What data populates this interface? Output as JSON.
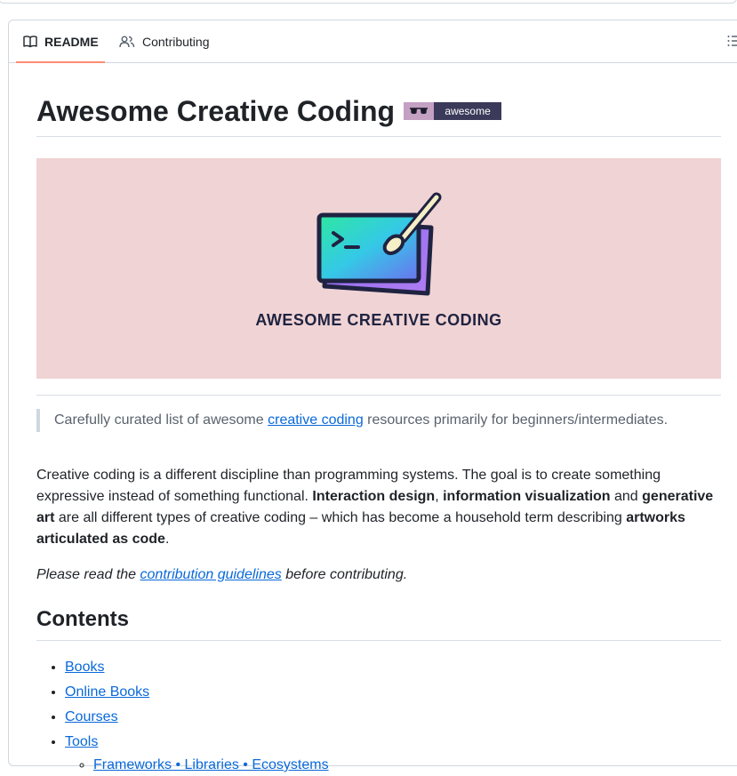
{
  "tabs": {
    "readme_label": "README",
    "contributing_label": "Contributing"
  },
  "readme": {
    "title": "Awesome Creative Coding",
    "badge_text": "awesome",
    "banner_text": "AWESOME CREATIVE CODING",
    "quote": {
      "before": "Carefully curated list of awesome ",
      "link": "creative coding",
      "after": " resources primarily for beginners/intermediates."
    },
    "paragraph": {
      "p1": "Creative coding is a different discipline than programming systems. The goal is to create something expressive instead of something functional. ",
      "b1": "Interaction design",
      "p2": ", ",
      "b2": "information visualization",
      "p3": " and ",
      "b3": "generative art",
      "p4": " are all different types of creative coding – which has become a household term describing ",
      "b4": "artworks articulated as code",
      "p5": "."
    },
    "note": {
      "before": "Please read the ",
      "link": "contribution guidelines",
      "after": " before contributing."
    },
    "contents_heading": "Contents",
    "toc": {
      "books": "Books",
      "online_books": "Online Books",
      "courses": "Courses",
      "tools": "Tools",
      "frameworks": "Frameworks • Libraries • Ecosystems"
    }
  },
  "colors": {
    "link": "#0969da",
    "active_tab_underline": "#fd8c73",
    "banner_background": "#f0d3d4"
  },
  "icons": [
    "book-icon",
    "people-icon",
    "list-unordered-icon",
    "glasses-icon",
    "terminal-paintbrush-logo"
  ]
}
